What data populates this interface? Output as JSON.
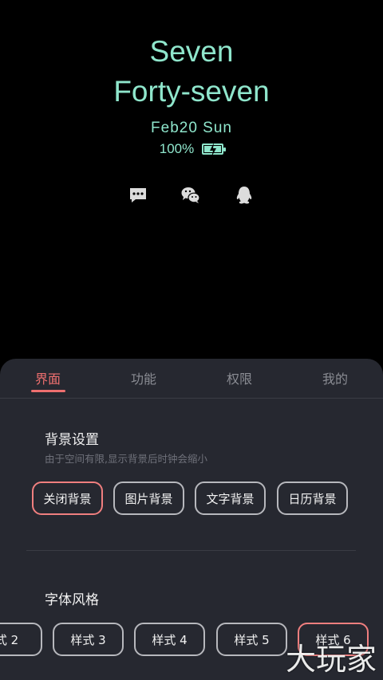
{
  "clock": {
    "time_line1": "Seven",
    "time_line2": "Forty-seven",
    "date": "Feb20 Sun",
    "battery": "100%",
    "accent_color": "#8fe6cc"
  },
  "notifications": [
    "message-icon",
    "wechat-icon",
    "qq-icon"
  ],
  "tabs": [
    "界面",
    "功能",
    "权限",
    "我的"
  ],
  "background_settings": {
    "title": "背景设置",
    "subtitle": "由于空间有限,显示背景后时钟会缩小",
    "options": [
      "关闭背景",
      "图片背景",
      "文字背景",
      "日历背景"
    ],
    "selected": "关闭背景"
  },
  "font_style": {
    "title": "字体风格",
    "options": [
      "式 2",
      "样式 3",
      "样式 4",
      "样式 5",
      "样式 6"
    ],
    "selected": "样式 6"
  },
  "watermark": "大玩家",
  "colors": {
    "sheet_bg": "#262830",
    "active": "#ee6f6f"
  }
}
